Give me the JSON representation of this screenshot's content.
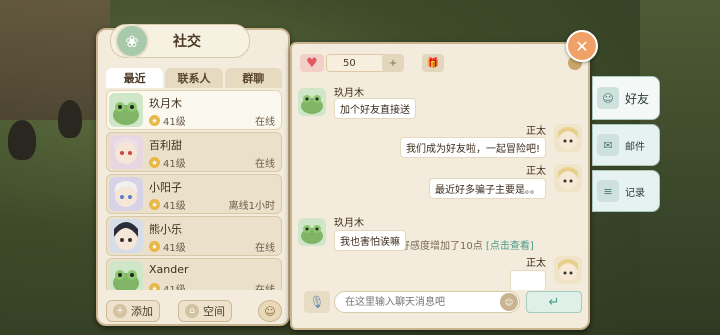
{
  "social_panel": {
    "title": "社交",
    "tabs": [
      "最近",
      "联系人",
      "群聊"
    ],
    "contacts": [
      {
        "name": "玖月木",
        "level": "41级",
        "status": "在线"
      },
      {
        "name": "百利甜",
        "level": "41级",
        "status": "在线"
      },
      {
        "name": "小阳子",
        "level": "41级",
        "status": "离线1小时"
      },
      {
        "name": "熊小乐",
        "level": "41级",
        "status": "在线"
      },
      {
        "name": "Xander",
        "level": "41级",
        "status": "在线"
      }
    ],
    "buttons": {
      "add": "添加",
      "space": "空间"
    }
  },
  "chat_panel": {
    "favorability": "50",
    "messages": [
      {
        "sender": "玖月木",
        "text": "加个好友直接送",
        "side": "left"
      },
      {
        "sender": "正太",
        "text": "我们成为好友啦，一起冒险吧!",
        "side": "right"
      },
      {
        "sender": "正太",
        "text": "最近好多骗子主要是。。",
        "side": "right"
      },
      {
        "sender": "玖月木",
        "text": "我也害怕诶嘛",
        "side": "left"
      },
      {
        "sender": "正太",
        "text": "",
        "side": "right"
      }
    ],
    "system_message": "你与玖月木的好感度增加了10点",
    "system_link": "[点击查看]",
    "input_placeholder": "在这里输入聊天消息吧"
  },
  "side_tabs": [
    {
      "label": "好友",
      "active": true
    },
    {
      "label": "邮件",
      "active": false
    },
    {
      "label": "记录",
      "active": false
    }
  ]
}
